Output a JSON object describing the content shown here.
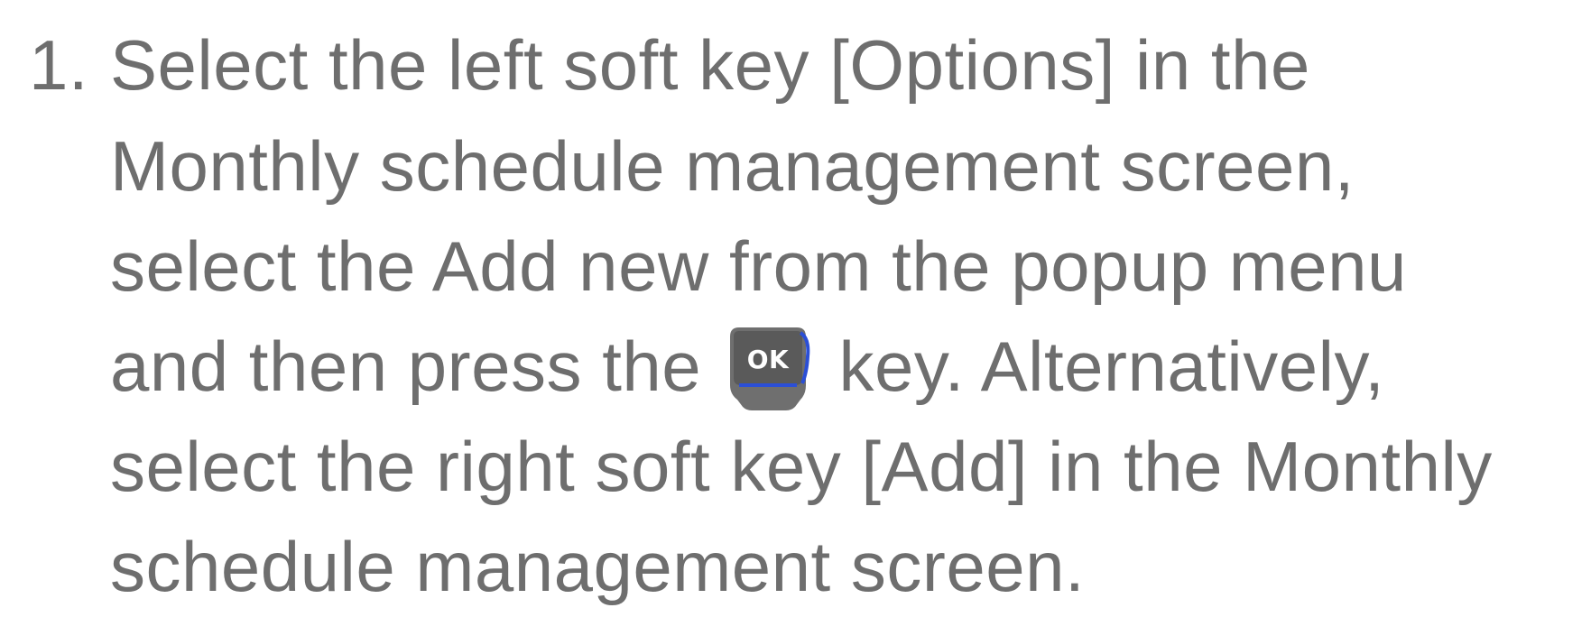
{
  "instruction": {
    "number": "1.",
    "lines": [
      "Select the left soft key [Options] in the",
      "Monthly schedule management screen,",
      "select the Add new from the popup menu",
      "and then press the",
      "key. Alternatively,",
      "select the right soft key [Add] in the Monthly",
      "schedule management screen."
    ],
    "key_icon": {
      "name": "ok-key-icon",
      "label": "OK",
      "colors": {
        "body": "#6f6f6f",
        "top": "#5a5a5a",
        "accent": "#2b4fd6",
        "text": "#ffffff"
      }
    }
  }
}
